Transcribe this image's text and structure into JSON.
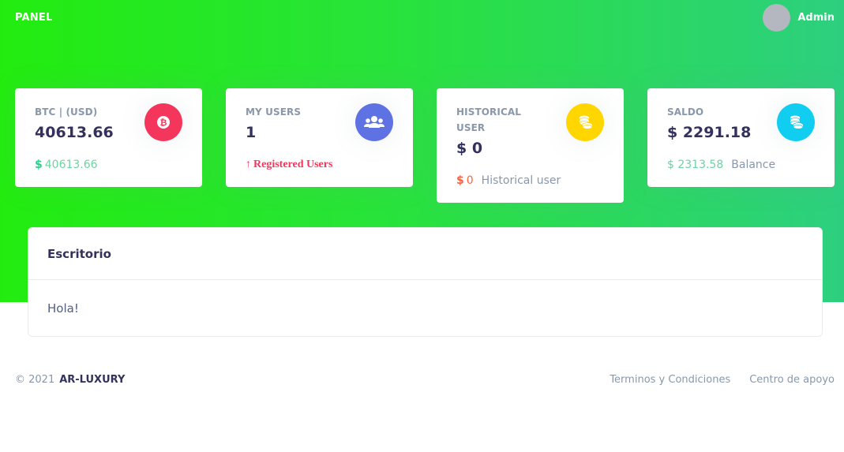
{
  "header": {
    "brand": "PANEL",
    "user_name": "Admin"
  },
  "cards": [
    {
      "title": "BTC | (USD)",
      "value": "40613.66",
      "icon": "bitcoin-icon",
      "icon_color": "#f5365c",
      "foot_symbol": "$",
      "foot_value": "40613.66",
      "foot_text": ""
    },
    {
      "title": "MY USERS",
      "value": "1",
      "icon": "users-icon",
      "icon_color": "#5e72e4",
      "foot_arrow": "↑",
      "foot_text": "Registered Users"
    },
    {
      "title": "HISTORICAL USER",
      "value": "$ 0",
      "icon": "coins-icon",
      "icon_color": "#ffd600",
      "foot_symbol": "$",
      "foot_value": "0",
      "foot_text": "Historical user"
    },
    {
      "title": "SALDO",
      "value": "$ 2291.18",
      "icon": "coins-icon",
      "icon_color": "#11cdef",
      "foot_value": "$ 2313.58",
      "foot_text": "Balance"
    }
  ],
  "desk": {
    "title": "Escritorio",
    "body": "Hola!"
  },
  "footer": {
    "copyright": "© 2021",
    "company": "AR-LUXURY",
    "links": [
      "Terminos y Condiciones",
      "Centro de apoyo"
    ]
  },
  "colors": {
    "gradient_start": "#22ec0f",
    "gradient_end": "#2dcf7f"
  }
}
